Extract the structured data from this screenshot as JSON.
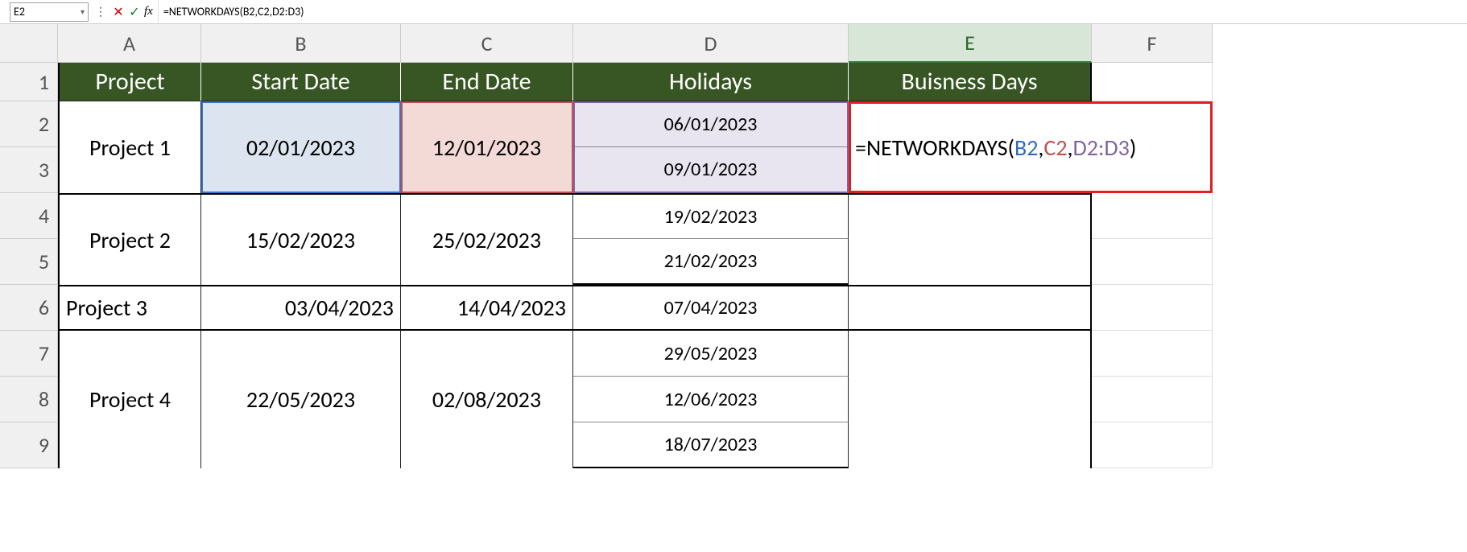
{
  "formula_bar": {
    "name_box": "E2",
    "formula_text": "=NETWORKDAYS(B2,C2,D2:D3)"
  },
  "columns": [
    "A",
    "B",
    "C",
    "D",
    "E",
    "F"
  ],
  "rows": [
    "1",
    "2",
    "3",
    "4",
    "5",
    "6",
    "7",
    "8",
    "9"
  ],
  "headers": {
    "project": "Project",
    "start": "Start Date",
    "end": "End Date",
    "holidays": "Holidays",
    "bdays": "Buisness Days"
  },
  "projects": [
    {
      "name": "Project 1",
      "start": "02/01/2023",
      "end": "12/01/2023",
      "holidays": [
        "06/01/2023",
        "09/01/2023"
      ]
    },
    {
      "name": "Project 2",
      "start": "15/02/2023",
      "end": "25/02/2023",
      "holidays": [
        "19/02/2023",
        "21/02/2023"
      ]
    },
    {
      "name": "Project 3",
      "start": "03/04/2023",
      "end": "14/04/2023",
      "holidays": [
        "07/04/2023"
      ]
    },
    {
      "name": "Project 4",
      "start": "22/05/2023",
      "end": "02/08/2023",
      "holidays": [
        "29/05/2023",
        "12/06/2023",
        "18/07/2023"
      ]
    }
  ],
  "active_cell_formula": {
    "prefix": "=NETWORKDAYS(",
    "arg1": "B2",
    "sep1": ",",
    "arg2": "C2",
    "sep2": ",",
    "arg3": "D2:D3",
    "suffix": ")"
  },
  "icons": {
    "dropdown": "▾",
    "cancel": "✕",
    "enter": "✓",
    "fx": "fx",
    "dots": "⋮"
  },
  "chart_data": {
    "type": "table",
    "title": "NETWORKDAYS example",
    "columns": [
      "Project",
      "Start Date",
      "End Date",
      "Holidays",
      "Buisness Days"
    ],
    "rows": [
      [
        "Project 1",
        "02/01/2023",
        "12/01/2023",
        "06/01/2023; 09/01/2023",
        "=NETWORKDAYS(B2,C2,D2:D3)"
      ],
      [
        "Project 2",
        "15/02/2023",
        "25/02/2023",
        "19/02/2023; 21/02/2023",
        ""
      ],
      [
        "Project 3",
        "03/04/2023",
        "14/04/2023",
        "07/04/2023",
        ""
      ],
      [
        "Project 4",
        "22/05/2023",
        "02/08/2023",
        "29/05/2023; 12/06/2023; 18/07/2023",
        ""
      ]
    ]
  }
}
